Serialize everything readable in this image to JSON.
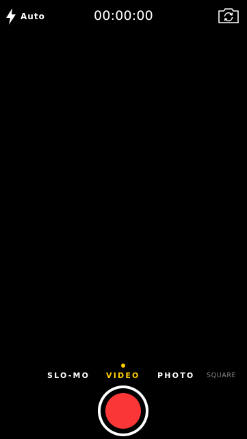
{
  "top_bar": {
    "flash": {
      "icon": "flash-bolt-icon",
      "label": "Auto"
    },
    "timer": "00:00:00",
    "flip_camera_icon": "camera-flip-icon"
  },
  "modes": {
    "items": [
      "SLO-MO",
      "VIDEO",
      "PHOTO",
      "SQUARE"
    ],
    "selected": "VIDEO"
  },
  "colors": {
    "background": "#000000",
    "selected_mode": "#ffcc00",
    "record": "#fb3636",
    "text": "#ffffff",
    "dimmed_text": "#8a8a8a"
  },
  "record_button": {
    "icon": "record-icon"
  }
}
